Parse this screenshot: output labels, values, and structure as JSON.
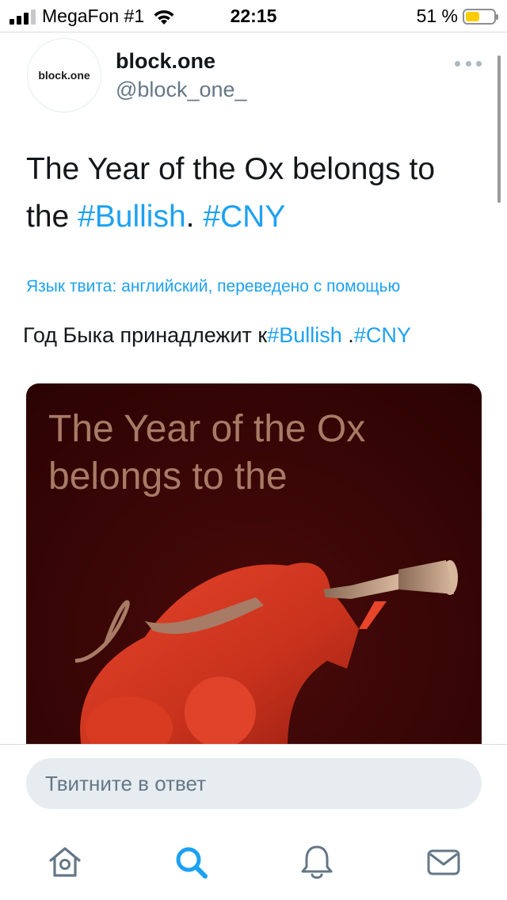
{
  "status_bar": {
    "carrier": "MegaFon #1",
    "time": "22:15",
    "battery_percent": "51 %",
    "battery_level": 0.51,
    "signal_bars_active": 3,
    "signal_bars_total": 4
  },
  "tweet": {
    "avatar_text": "block.one",
    "display_name": "block.one",
    "handle": "@block_one_",
    "text_main": "The Year of the Ox belongs to the ",
    "tag1": "#Bullish",
    "sep": ". ",
    "tag2": "#CNY",
    "translation_note": "Язык твита: английский, переведено с помощью",
    "translated_main": "Год Быка принадлежит к",
    "translated_tag1": "#Bullish",
    "translated_sep": " .",
    "translated_tag2": "#CNY",
    "media_caption": "The Year of the Ox belongs to the"
  },
  "reply": {
    "placeholder": "Твитните в ответ"
  },
  "tabbar": {
    "items": [
      {
        "icon": "home-icon"
      },
      {
        "icon": "search-icon",
        "active": true
      },
      {
        "icon": "notifications-icon"
      },
      {
        "icon": "messages-icon"
      }
    ]
  },
  "colors": {
    "accent": "#1da1f2",
    "media_text": "#a87b66",
    "battery": "#ffcc00"
  }
}
